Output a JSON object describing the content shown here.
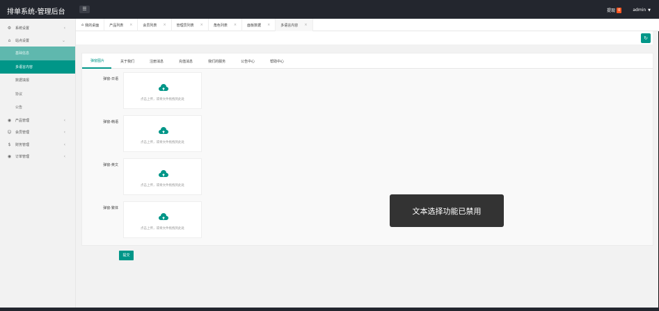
{
  "header": {
    "brand": "排单系统-管理后台",
    "notice_label": "提现",
    "notice_count": "0",
    "user": "admin"
  },
  "sidebar": {
    "items": [
      {
        "label": "系统设置",
        "icon": "gear-icon"
      },
      {
        "label": "站点设置",
        "icon": "home-icon"
      }
    ],
    "subitems": [
      "基础信息",
      "多语言内容",
      "数据填报",
      "协议",
      "公告"
    ],
    "more": [
      {
        "label": "产品管理",
        "icon": "product-icon"
      },
      {
        "label": "会员管理",
        "icon": "user-icon"
      },
      {
        "label": "财务管理",
        "icon": "money-icon"
      },
      {
        "label": "订单管理",
        "icon": "order-icon"
      }
    ]
  },
  "tabs": [
    "我的桌面",
    "产品列表",
    "会员列表",
    "管理员列表",
    "角色列表",
    "面板数据",
    "多语言内容"
  ],
  "content_tabs": [
    "弹窗图片",
    "关于我们",
    "注册消息",
    "充值消息",
    "我们的服务",
    "公告中心",
    "帮助中心"
  ],
  "uploads": [
    {
      "label": "弹窗-日语"
    },
    {
      "label": "弹窗-韩语"
    },
    {
      "label": "弹窗-英文"
    },
    {
      "label": "弹窗-繁体"
    }
  ],
  "upload_hint": "点击上传，或将文件拖拽到此处",
  "submit_label": "提交",
  "toast": "文本选择功能已禁用",
  "colors": {
    "accent": "#009688",
    "header": "#23262e",
    "badge": "#ff5722"
  }
}
